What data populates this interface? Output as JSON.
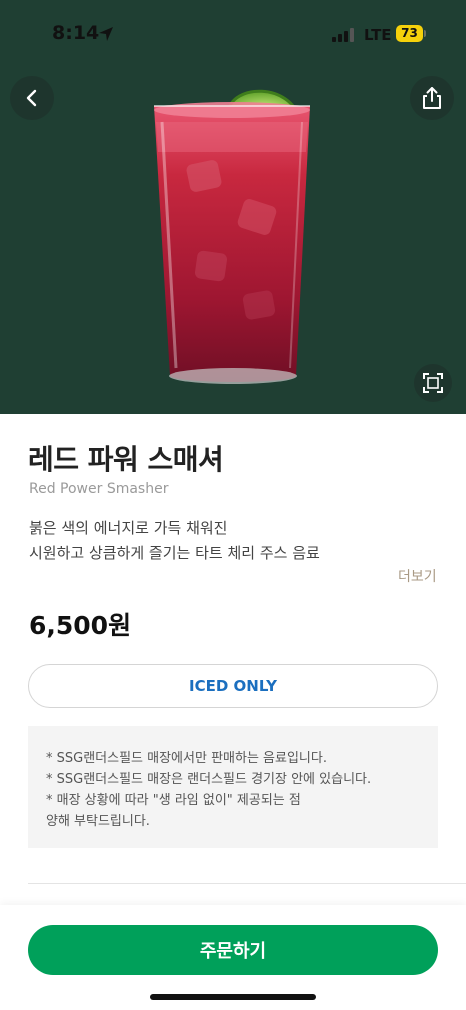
{
  "status_bar": {
    "time": "8:14",
    "network": "LTE",
    "battery": "73",
    "icons": [
      "location-arrow-icon",
      "signal-icon",
      "battery-icon"
    ]
  },
  "header": {
    "icons": [
      "back-icon",
      "share-icon",
      "fullscreen-icon"
    ]
  },
  "product": {
    "name_ko": "레드 파워 스매셔",
    "name_en": "Red Power Smasher",
    "description_lines": [
      "붉은 색의 에너지로 가득 채워진",
      "시원하고 상큼하게 즐기는 타트 체리 주스 음료"
    ],
    "more_label": "더보기",
    "price": "6,500원",
    "temperature_option": "ICED ONLY"
  },
  "notice": {
    "lines": [
      "* SSG랜더스필드 매장에서만 판매하는 음료입니다.",
      "* SSG랜더스필드 매장은 랜더스필드 경기장 안에 있습니다.",
      "* 매장 상황에 따라 \"생 라임 없이\" 제공되는 점",
      "양해 부탁드립니다."
    ]
  },
  "actions": {
    "order_label": "주문하기"
  },
  "colors": {
    "hero_bg": "#1f3f33",
    "primary_green": "#00a05a",
    "iced_blue": "#1b6fbf",
    "more_text": "#a99a85",
    "battery_yellow": "#f5d10b"
  }
}
